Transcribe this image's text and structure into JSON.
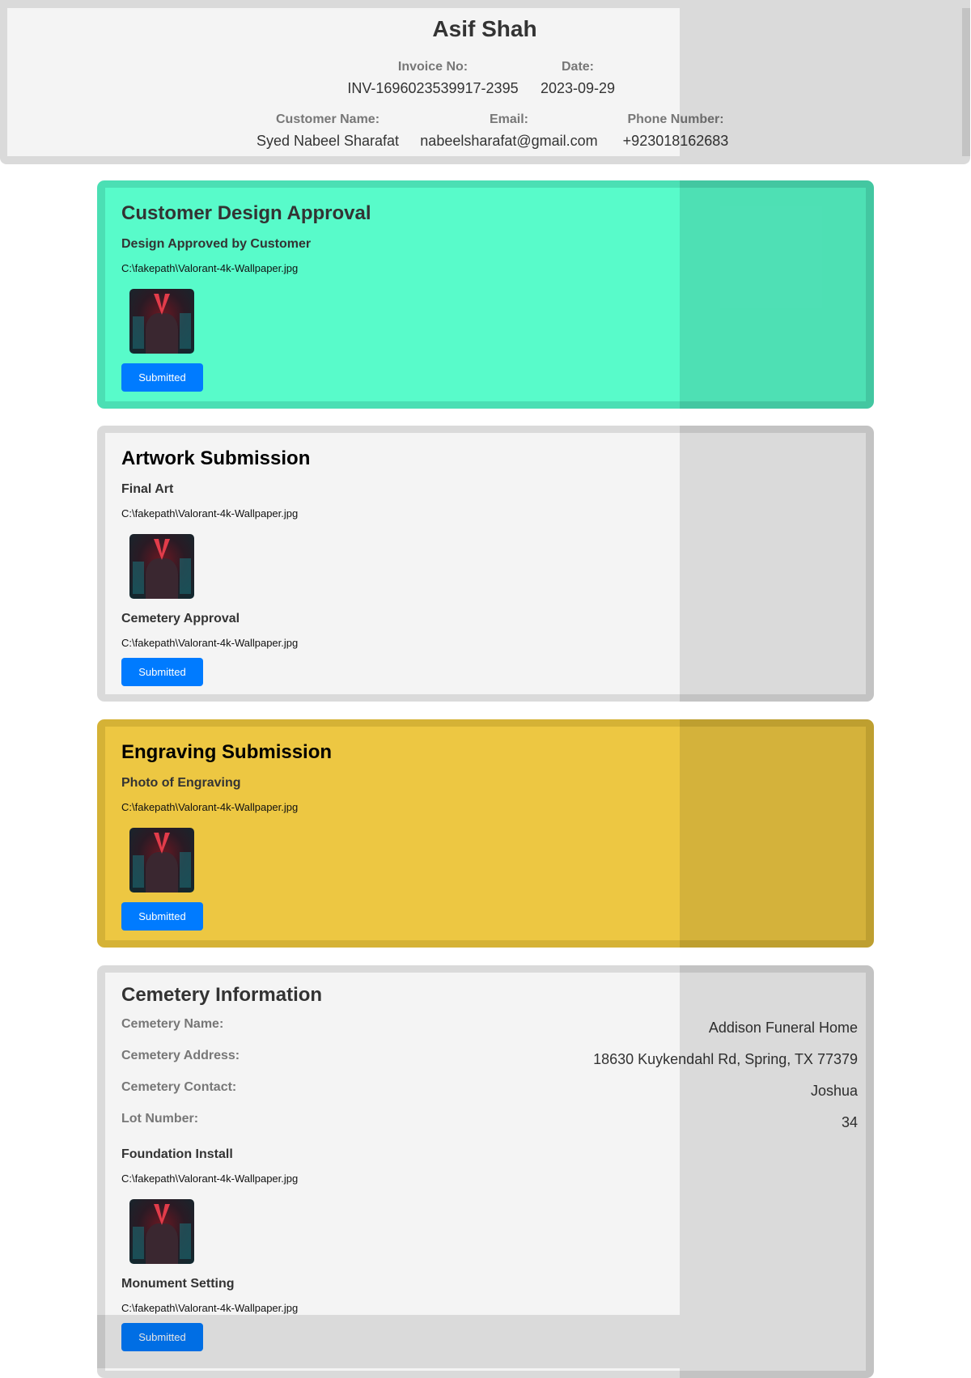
{
  "header": {
    "name": "Asif Shah",
    "invoice_label": "Invoice No:",
    "invoice_value": "INV-1696023539917-2395",
    "date_label": "Date:",
    "date_value": "2023-09-29",
    "customer_label": "Customer Name:",
    "customer_value": "Syed Nabeel Sharafat",
    "email_label": "Email:",
    "email_value": "nabeelsharafat@gmail.com",
    "phone_label": "Phone Number:",
    "phone_value": "+923018162683"
  },
  "design_approval": {
    "title": "Customer Design Approval",
    "subtitle": "Design Approved by Customer",
    "file": "C:\\fakepath\\Valorant-4k-Wallpaper.jpg",
    "button": "Submitted",
    "color": "#58fbca"
  },
  "artwork": {
    "title": "Artwork Submission",
    "final_art_label": "Final Art",
    "final_art_file": "C:\\fakepath\\Valorant-4k-Wallpaper.jpg",
    "cemetery_approval_label": "Cemetery Approval",
    "cemetery_approval_file": "C:\\fakepath\\Valorant-4k-Wallpaper.jpg",
    "button": "Submitted"
  },
  "engraving": {
    "title": "Engraving Submission",
    "photo_label": "Photo of Engraving",
    "photo_file": "C:\\fakepath\\Valorant-4k-Wallpaper.jpg",
    "button": "Submitted",
    "color": "#edc742"
  },
  "cemetery": {
    "title": "Cemetery Information",
    "rows": [
      {
        "label": "Cemetery Name:",
        "value": "Addison Funeral Home"
      },
      {
        "label": "Cemetery Address:",
        "value": "18630 Kuykendahl Rd, Spring, TX 77379"
      },
      {
        "label": "Cemetery Contact:",
        "value": "Joshua"
      },
      {
        "label": "Lot Number:",
        "value": "34"
      }
    ],
    "foundation_label": "Foundation Install",
    "foundation_file": "C:\\fakepath\\Valorant-4k-Wallpaper.jpg",
    "monument_label": "Monument Setting",
    "monument_file": "C:\\fakepath\\Valorant-4k-Wallpaper.jpg",
    "button": "Submitted"
  },
  "colors": {
    "button": "#007bff"
  }
}
